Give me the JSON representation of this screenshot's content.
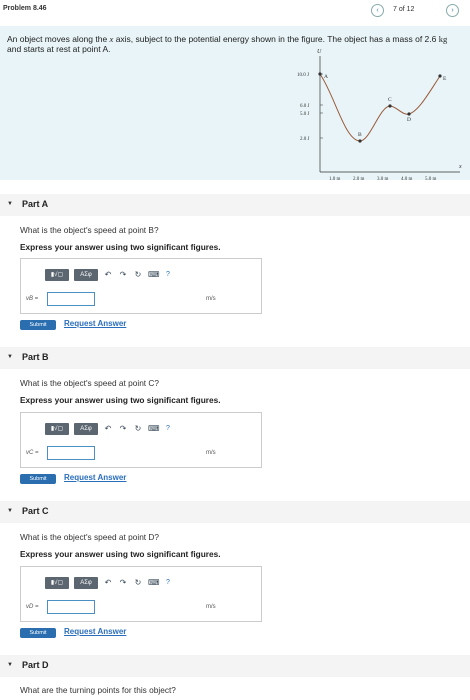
{
  "header": {
    "problem_title": "Problem 8.46",
    "pager": "7 of 12",
    "prev_icon": "chevron-left-icon",
    "next_icon": "chevron-right-icon"
  },
  "problem": {
    "text_before": "An object moves along the ",
    "var_x": "x",
    "text_mid": " axis, subject to the potential energy shown in the figure. The object has a mass of 2.6 ",
    "unit_kg": "kg",
    "text_after": " and starts at rest at point A.",
    "figure": {
      "y_axis_label": "U",
      "y_ticks": [
        "10.0 J",
        "6.0 J",
        "5.0 J",
        "2.0 J"
      ],
      "x_ticks": [
        "1.0 m",
        "2.0 m",
        "3.0 m",
        "4.0 m",
        "5.0 m"
      ],
      "x_axis_label": "x",
      "points": [
        "A",
        "B",
        "C",
        "D",
        "E"
      ]
    }
  },
  "toolbar": {
    "matrix_label": "▮√▢",
    "greek_label": "ΑΣφ",
    "undo_icon": "undo-icon",
    "redo_icon": "redo-icon",
    "reset_icon": "reset-icon",
    "keyboard_icon": "keyboard-icon",
    "help_label": "?"
  },
  "parts": [
    {
      "title": "Part A",
      "question": "What is the object's speed at point B?",
      "instruction": "Express your answer using two significant figures.",
      "var_label": "vB =",
      "unit": "m/s",
      "submit": "Submit",
      "request": "Request Answer"
    },
    {
      "title": "Part B",
      "question": "What is the object's speed at point C?",
      "instruction": "Express your answer using two significant figures.",
      "var_label": "vC =",
      "unit": "m/s",
      "submit": "Submit",
      "request": "Request Answer"
    },
    {
      "title": "Part C",
      "question": "What is the object's speed at point D?",
      "instruction": "Express your answer using two significant figures.",
      "var_label": "vD =",
      "unit": "m/s",
      "submit": "Submit",
      "request": "Request Answer"
    },
    {
      "title": "Part D",
      "question": "What are the turning points for this object?"
    }
  ]
}
